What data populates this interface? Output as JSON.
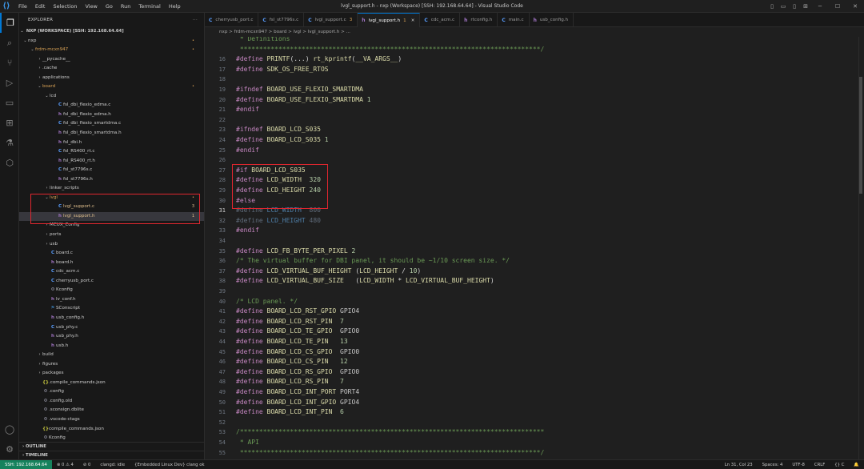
{
  "titlebar": {
    "menu": [
      "File",
      "Edit",
      "Selection",
      "View",
      "Go",
      "Run",
      "Terminal",
      "Help"
    ],
    "title": "lvgl_support.h - nxp (Workspace) [SSH: 192.168.64.64] - Visual Studio Code"
  },
  "sidebar": {
    "header": "EXPLORER",
    "workspace": "NXP (WORKSPACE) [SSH: 192.168.64.64]",
    "tree": [
      {
        "label": "nxp",
        "depth": 0,
        "type": "folder",
        "open": true,
        "badge": "•"
      },
      {
        "label": "frdm-mcxn947",
        "depth": 1,
        "type": "folder",
        "open": true,
        "badge": "•",
        "color": "mod"
      },
      {
        "label": "__pycache__",
        "depth": 2,
        "type": "folder"
      },
      {
        "label": ".cache",
        "depth": 2,
        "type": "folder"
      },
      {
        "label": "applications",
        "depth": 2,
        "type": "folder"
      },
      {
        "label": "board",
        "depth": 2,
        "type": "folder",
        "open": true,
        "badge": "•",
        "color": "mod"
      },
      {
        "label": "lcd",
        "depth": 3,
        "type": "folder",
        "open": true
      },
      {
        "label": "fsl_dbi_flexio_edma.c",
        "depth": 4,
        "type": "c"
      },
      {
        "label": "fsl_dbi_flexio_edma.h",
        "depth": 4,
        "type": "h"
      },
      {
        "label": "fsl_dbi_flexio_smartdma.c",
        "depth": 4,
        "type": "c"
      },
      {
        "label": "fsl_dbi_flexio_smartdma.h",
        "depth": 4,
        "type": "h"
      },
      {
        "label": "fsl_dbi.h",
        "depth": 4,
        "type": "h"
      },
      {
        "label": "fsl_RS400_rt.c",
        "depth": 4,
        "type": "c"
      },
      {
        "label": "fsl_RS400_rt.h",
        "depth": 4,
        "type": "h"
      },
      {
        "label": "fsl_st7796s.c",
        "depth": 4,
        "type": "c"
      },
      {
        "label": "fsl_st7796s.h",
        "depth": 4,
        "type": "h"
      },
      {
        "label": "linker_scripts",
        "depth": 3,
        "type": "folder"
      },
      {
        "label": "lvgl",
        "depth": 3,
        "type": "folder",
        "open": true,
        "badge": "•",
        "color": "mod"
      },
      {
        "label": "lvgl_support.c",
        "depth": 4,
        "type": "c",
        "badge": "3",
        "color": "modc"
      },
      {
        "label": "lvgl_support.h",
        "depth": 4,
        "type": "h",
        "badge": "1",
        "color": "modc",
        "selected": true
      },
      {
        "label": "MCUX_Config",
        "depth": 3,
        "type": "folder"
      },
      {
        "label": "ports",
        "depth": 3,
        "type": "folder"
      },
      {
        "label": "usb",
        "depth": 3,
        "type": "folder"
      },
      {
        "label": "board.c",
        "depth": 3,
        "type": "c"
      },
      {
        "label": "board.h",
        "depth": 3,
        "type": "h"
      },
      {
        "label": "cdc_acm.c",
        "depth": 3,
        "type": "c"
      },
      {
        "label": "cherryusb_port.c",
        "depth": 3,
        "type": "c"
      },
      {
        "label": "Kconfig",
        "depth": 3,
        "type": "gear"
      },
      {
        "label": "lv_conf.h",
        "depth": 3,
        "type": "h"
      },
      {
        "label": "SConscript",
        "depth": 3,
        "type": "py"
      },
      {
        "label": "usb_config.h",
        "depth": 3,
        "type": "h"
      },
      {
        "label": "usb_phy.c",
        "depth": 3,
        "type": "c"
      },
      {
        "label": "usb_phy.h",
        "depth": 3,
        "type": "h"
      },
      {
        "label": "usb.h",
        "depth": 3,
        "type": "h"
      },
      {
        "label": "build",
        "depth": 2,
        "type": "folder"
      },
      {
        "label": "figures",
        "depth": 2,
        "type": "folder"
      },
      {
        "label": "packages",
        "depth": 2,
        "type": "folder"
      },
      {
        "label": ".compile_commands.json",
        "depth": 2,
        "type": "json"
      },
      {
        "label": ".config",
        "depth": 2,
        "type": "gear"
      },
      {
        "label": ".config.old",
        "depth": 2,
        "type": "gear"
      },
      {
        "label": ".sconsign.dblite",
        "depth": 2,
        "type": "gear"
      },
      {
        "label": ".vscode-ctags",
        "depth": 2,
        "type": "gear"
      },
      {
        "label": "compile_commands.json",
        "depth": 2,
        "type": "json"
      },
      {
        "label": "Kconfig",
        "depth": 2,
        "type": "gear"
      }
    ],
    "sections": [
      "OUTLINE",
      "TIMELINE"
    ]
  },
  "tabs": [
    {
      "label": "cherryusb_port.c",
      "type": "c"
    },
    {
      "label": "fsl_st7796s.c",
      "type": "c"
    },
    {
      "label": "lvgl_support.c 3",
      "type": "c"
    },
    {
      "label": "lvgl_support.h 1",
      "type": "h",
      "active": true
    },
    {
      "label": "cdc_acm.c",
      "type": "c"
    },
    {
      "label": "rtconfig.h",
      "type": "h"
    },
    {
      "label": "main.c",
      "type": "c"
    },
    {
      "label": "usb_config.h",
      "type": "h"
    }
  ],
  "breadcrumb": "nxp > frdm-mcxn947 > board > lvgl > lvgl_support.h > ...",
  "editor": {
    "current_line": 31,
    "lines": [
      {
        "n": "",
        "segs": [
          [
            "cm",
            " * Definitions"
          ]
        ]
      },
      {
        "n": "",
        "segs": [
          [
            "cm",
            " ******************************************************************************/"
          ]
        ]
      },
      {
        "n": "16",
        "segs": [
          [
            "k",
            "#define "
          ],
          [
            "m",
            "PRINTF"
          ],
          [
            "pl",
            "(...) "
          ],
          [
            "m",
            "rt_kprintf"
          ],
          [
            "pl",
            "("
          ],
          [
            "m",
            "__VA_ARGS__"
          ],
          [
            "pl",
            ")"
          ]
        ]
      },
      {
        "n": "17",
        "segs": [
          [
            "k",
            "#define "
          ],
          [
            "m",
            "SDK_OS_FREE_RTOS"
          ]
        ]
      },
      {
        "n": "18",
        "segs": []
      },
      {
        "n": "19",
        "segs": [
          [
            "k",
            "#ifndef "
          ],
          [
            "m",
            "BOARD_USE_FLEXIO_SMARTDMA"
          ]
        ]
      },
      {
        "n": "20",
        "segs": [
          [
            "k",
            "#define "
          ],
          [
            "m",
            "BOARD_USE_FLEXIO_SMARTDMA "
          ],
          [
            "n",
            "1"
          ]
        ]
      },
      {
        "n": "21",
        "segs": [
          [
            "k",
            "#endif"
          ]
        ]
      },
      {
        "n": "22",
        "segs": []
      },
      {
        "n": "23",
        "segs": [
          [
            "k",
            "#ifndef "
          ],
          [
            "m",
            "BOARD_LCD_S035"
          ]
        ]
      },
      {
        "n": "24",
        "segs": [
          [
            "k",
            "#define "
          ],
          [
            "m",
            "BOARD_LCD_S035 "
          ],
          [
            "n",
            "1"
          ]
        ]
      },
      {
        "n": "25",
        "segs": [
          [
            "k",
            "#endif"
          ]
        ]
      },
      {
        "n": "26",
        "segs": []
      },
      {
        "n": "27",
        "segs": [
          [
            "k",
            "#if "
          ],
          [
            "m",
            "BOARD_LCD_S035"
          ]
        ]
      },
      {
        "n": "28",
        "segs": [
          [
            "k",
            "#define "
          ],
          [
            "m",
            "LCD_WIDTH  "
          ],
          [
            "n",
            "320"
          ]
        ]
      },
      {
        "n": "29",
        "segs": [
          [
            "k",
            "#define "
          ],
          [
            "m",
            "LCD_HEIGHT "
          ],
          [
            "n",
            "240"
          ]
        ]
      },
      {
        "n": "30",
        "segs": [
          [
            "k",
            "#else"
          ]
        ]
      },
      {
        "n": "31",
        "segs": [
          [
            "dim",
            "#define "
          ],
          [
            "dimb",
            "LCD_WIDTH  "
          ],
          [
            "dim",
            "800"
          ]
        ]
      },
      {
        "n": "32",
        "segs": [
          [
            "dim",
            "#define "
          ],
          [
            "dimb",
            "LCD_HEIGHT "
          ],
          [
            "dim",
            "480"
          ]
        ]
      },
      {
        "n": "33",
        "segs": [
          [
            "k",
            "#endif"
          ]
        ]
      },
      {
        "n": "34",
        "segs": []
      },
      {
        "n": "35",
        "segs": [
          [
            "k",
            "#define "
          ],
          [
            "m",
            "LCD_FB_BYTE_PER_PIXEL "
          ],
          [
            "n",
            "2"
          ]
        ]
      },
      {
        "n": "36",
        "segs": [
          [
            "cm",
            "/* The virtual buffer for DBI panel, it should be ~1/10 screen size. */"
          ]
        ]
      },
      {
        "n": "37",
        "segs": [
          [
            "k",
            "#define "
          ],
          [
            "m",
            "LCD_VIRTUAL_BUF_HEIGHT "
          ],
          [
            "pl",
            "("
          ],
          [
            "m",
            "LCD_HEIGHT"
          ],
          [
            "pl",
            " / "
          ],
          [
            "n",
            "10"
          ],
          [
            "pl",
            ")"
          ]
        ]
      },
      {
        "n": "38",
        "segs": [
          [
            "k",
            "#define "
          ],
          [
            "m",
            "LCD_VIRTUAL_BUF_SIZE   "
          ],
          [
            "pl",
            "("
          ],
          [
            "m",
            "LCD_WIDTH"
          ],
          [
            "pl",
            " * "
          ],
          [
            "m",
            "LCD_VIRTUAL_BUF_HEIGHT"
          ],
          [
            "pl",
            ")"
          ]
        ]
      },
      {
        "n": "39",
        "segs": []
      },
      {
        "n": "40",
        "segs": [
          [
            "cm",
            "/* LCD panel. */"
          ]
        ]
      },
      {
        "n": "41",
        "segs": [
          [
            "k",
            "#define "
          ],
          [
            "m",
            "BOARD_LCD_RST_GPIO "
          ],
          [
            "mc",
            "GPIO4"
          ]
        ]
      },
      {
        "n": "42",
        "segs": [
          [
            "k",
            "#define "
          ],
          [
            "m",
            "BOARD_LCD_RST_PIN  "
          ],
          [
            "n",
            "7"
          ]
        ]
      },
      {
        "n": "43",
        "segs": [
          [
            "k",
            "#define "
          ],
          [
            "m",
            "BOARD_LCD_TE_GPIO  "
          ],
          [
            "mc",
            "GPIO0"
          ]
        ]
      },
      {
        "n": "44",
        "segs": [
          [
            "k",
            "#define "
          ],
          [
            "m",
            "BOARD_LCD_TE_PIN   "
          ],
          [
            "n",
            "13"
          ]
        ]
      },
      {
        "n": "45",
        "segs": [
          [
            "k",
            "#define "
          ],
          [
            "m",
            "BOARD_LCD_CS_GPIO  "
          ],
          [
            "mc",
            "GPIO0"
          ]
        ]
      },
      {
        "n": "46",
        "segs": [
          [
            "k",
            "#define "
          ],
          [
            "m",
            "BOARD_LCD_CS_PIN   "
          ],
          [
            "n",
            "12"
          ]
        ]
      },
      {
        "n": "47",
        "segs": [
          [
            "k",
            "#define "
          ],
          [
            "m",
            "BOARD_LCD_RS_GPIO  "
          ],
          [
            "mc",
            "GPIO0"
          ]
        ]
      },
      {
        "n": "48",
        "segs": [
          [
            "k",
            "#define "
          ],
          [
            "m",
            "BOARD_LCD_RS_PIN   "
          ],
          [
            "n",
            "7"
          ]
        ]
      },
      {
        "n": "49",
        "segs": [
          [
            "k",
            "#define "
          ],
          [
            "m",
            "BOARD_LCD_INT_PORT "
          ],
          [
            "mc",
            "PORT4"
          ]
        ]
      },
      {
        "n": "50",
        "segs": [
          [
            "k",
            "#define "
          ],
          [
            "m",
            "BOARD_LCD_INT_GPIO "
          ],
          [
            "mc",
            "GPIO4"
          ]
        ]
      },
      {
        "n": "51",
        "segs": [
          [
            "k",
            "#define "
          ],
          [
            "m",
            "BOARD_LCD_INT_PIN  "
          ],
          [
            "n",
            "6"
          ]
        ]
      },
      {
        "n": "52",
        "segs": []
      },
      {
        "n": "53",
        "segs": [
          [
            "cm",
            "/*******************************************************************************"
          ]
        ]
      },
      {
        "n": "54",
        "segs": [
          [
            "cm",
            " * API"
          ]
        ]
      },
      {
        "n": "55",
        "segs": [
          [
            "cm",
            " ******************************************************************************/"
          ]
        ]
      }
    ]
  },
  "status": {
    "remote": "SSH: 192.168.64.64",
    "errors": "⊗ 0 ⚠ 4",
    "warn_extra": "⊘ 0",
    "clangd": "clangd: idle",
    "linux": "{Embedded Linux Dev} clang ok",
    "position": "Ln 31, Col 23",
    "spaces": "Spaces: 4",
    "encoding": "UTF-8",
    "eol": "CRLF",
    "lang": "{} C"
  },
  "colors": {
    "accent": "#0078d4",
    "highlight_box": "#e0262f",
    "remote": "#16825d"
  }
}
